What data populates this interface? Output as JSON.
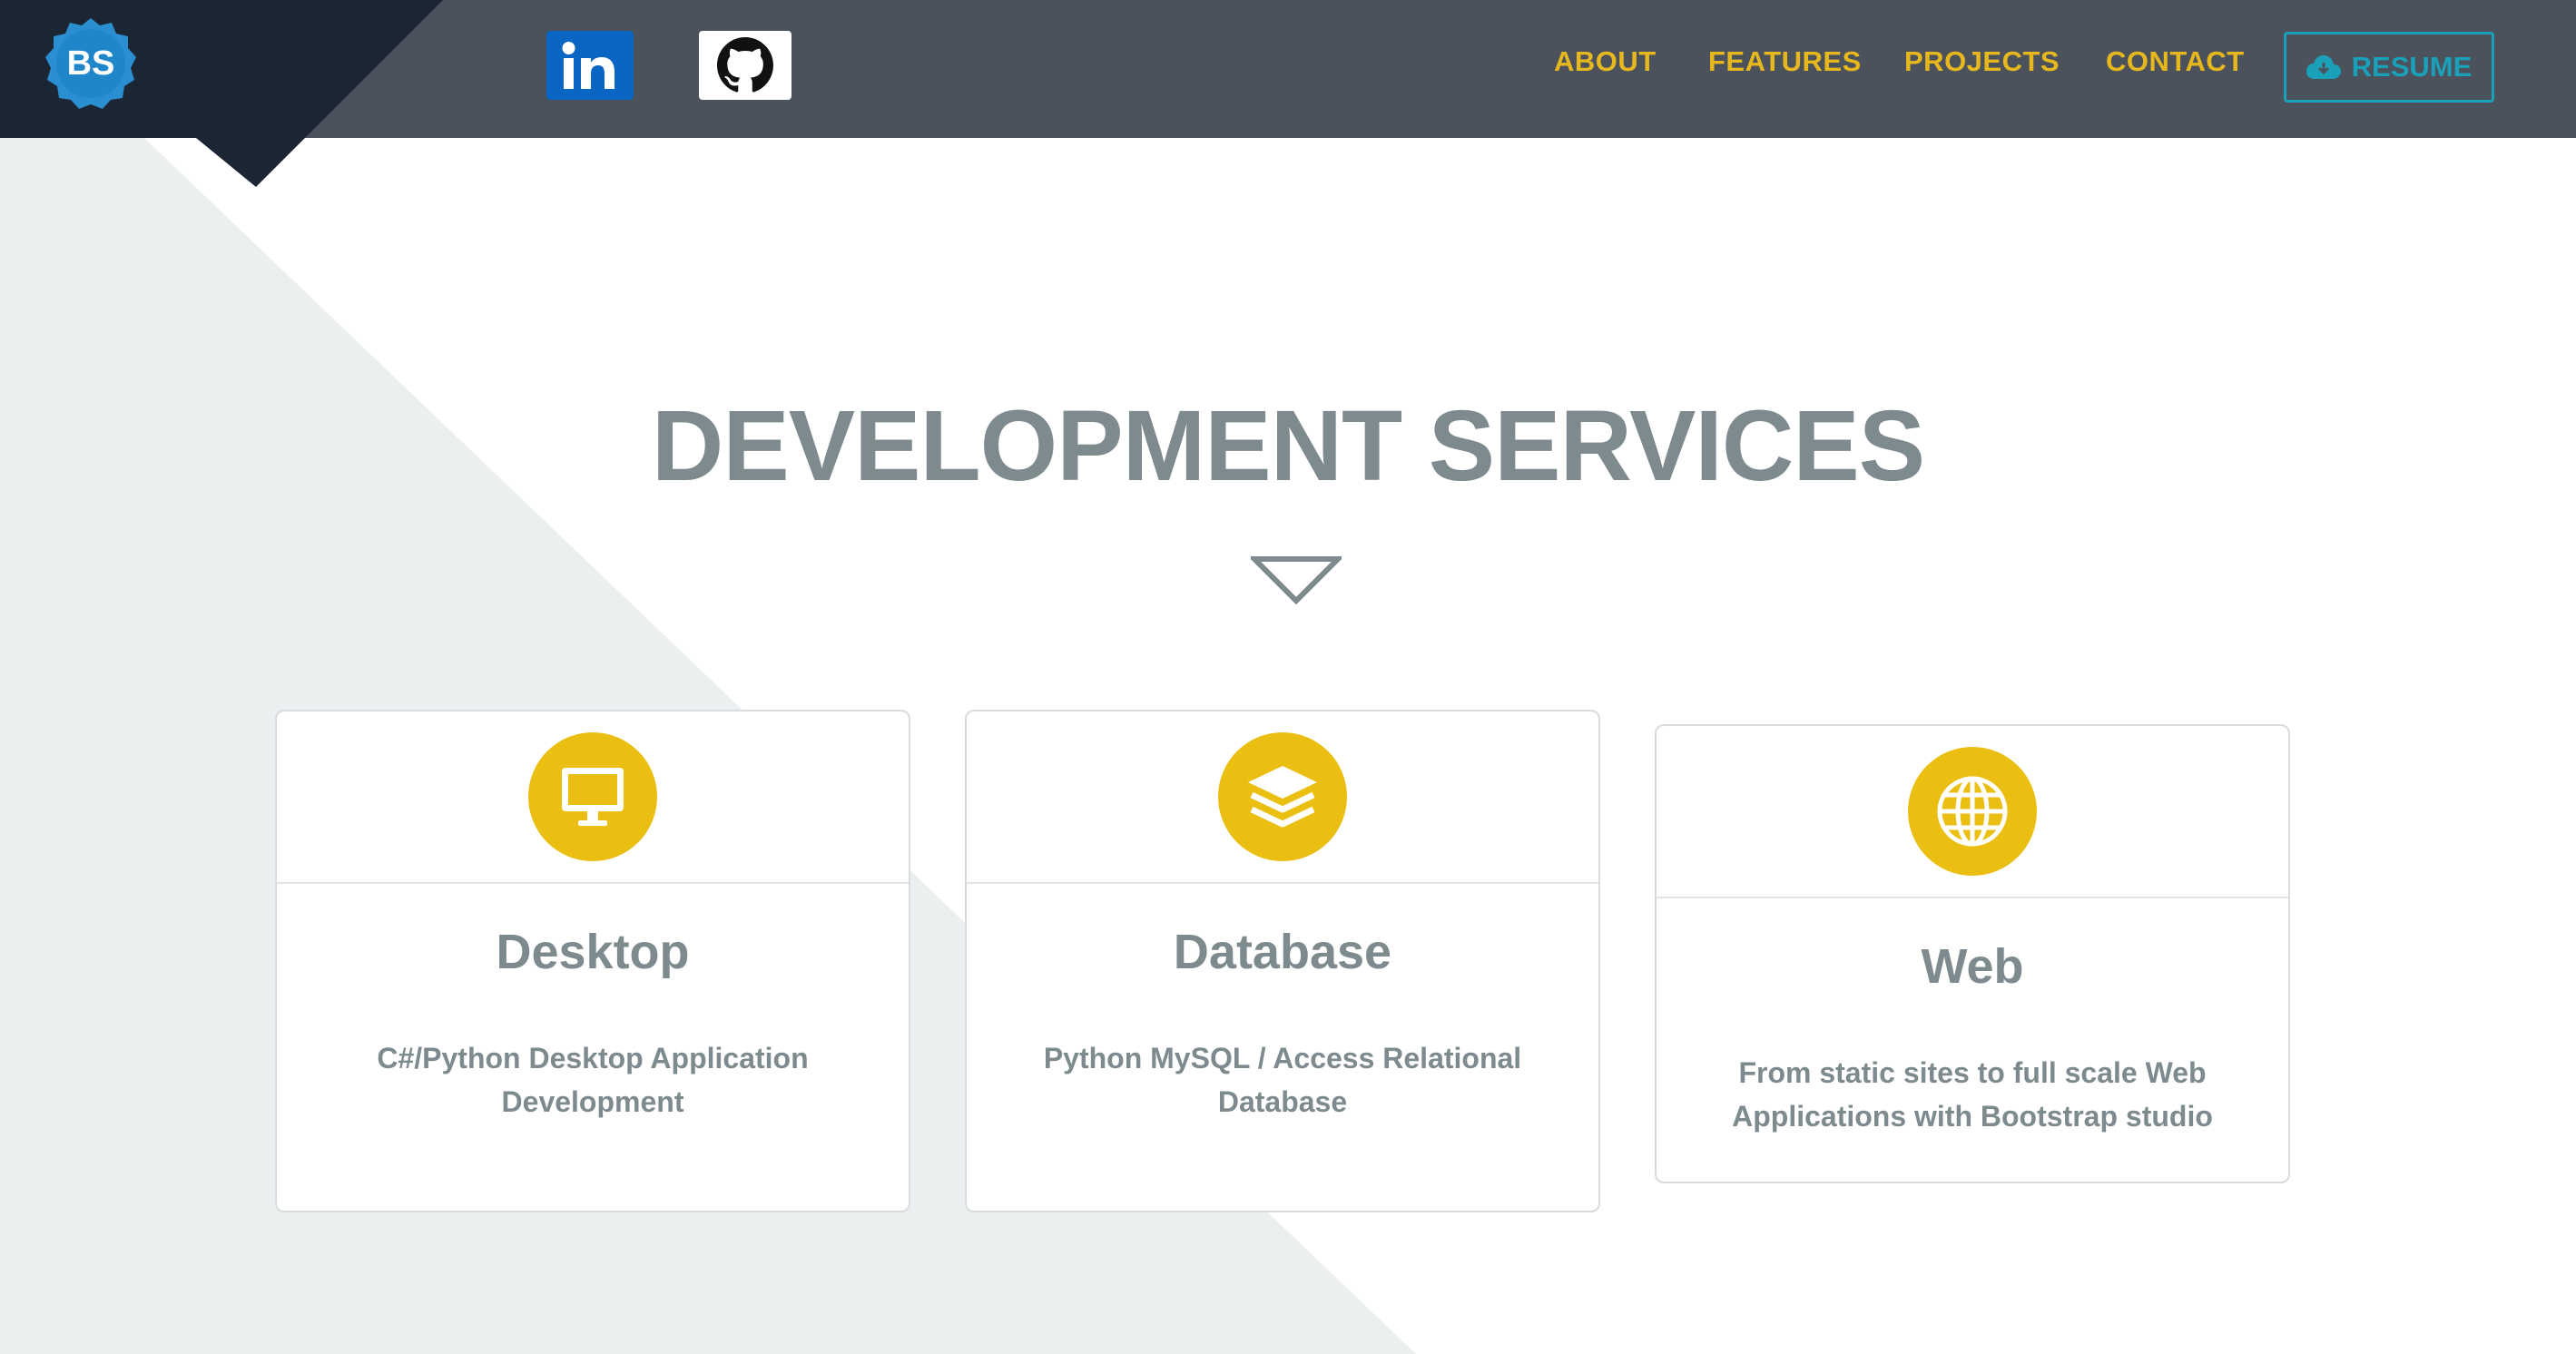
{
  "brand": {
    "logo_text": "BS"
  },
  "social": [
    {
      "name": "LinkedIn",
      "icon": "linkedin-icon"
    },
    {
      "name": "GitHub",
      "icon": "github-icon"
    }
  ],
  "nav": {
    "links": [
      "ABOUT",
      "FEATURES",
      "PROJECTS",
      "CONTACT"
    ],
    "resume_label": "RESUME",
    "resume_icon": "cloud-download-icon"
  },
  "section": {
    "title": "DEVELOPMENT SERVICES",
    "cards": [
      {
        "title": "Desktop",
        "description": "C#/Python Desktop Application Development",
        "icon": "monitor-icon"
      },
      {
        "title": "Database",
        "description": "Python MySQL / Access Relational Database",
        "icon": "layers-icon"
      },
      {
        "title": "Web",
        "description": "From static sites to full scale Web Applications with Bootstrap studio",
        "icon": "globe-icon"
      }
    ]
  },
  "colors": {
    "navbar": "#4b525c",
    "nav_link": "#e7b81d",
    "accent_teal": "#1aa0b9",
    "icon_yellow": "#ebbe12",
    "heading_gray": "#7d8a8e",
    "bg_triangle": "#eceff0",
    "corner_dark": "#1c2533"
  }
}
